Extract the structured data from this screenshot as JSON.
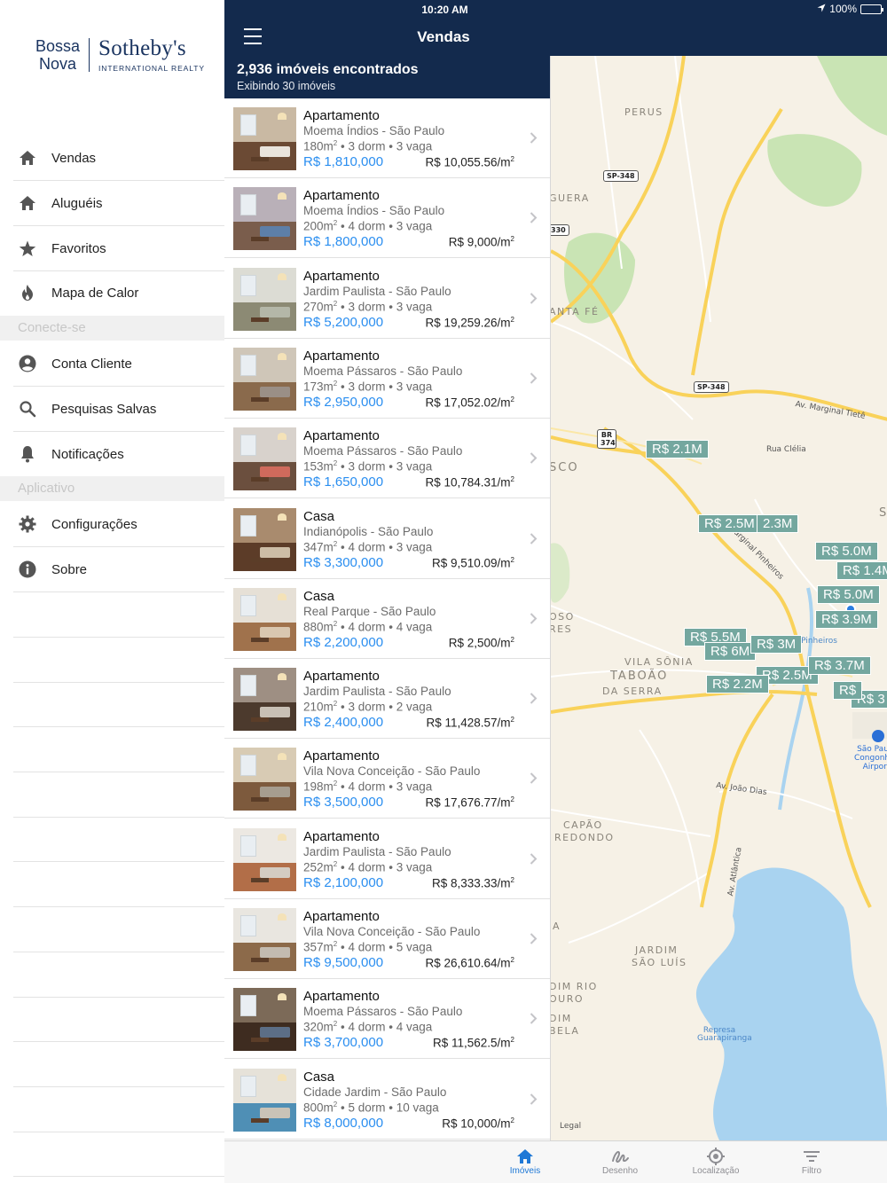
{
  "brand": {
    "line1": "Bossa",
    "line2": "Nova",
    "name": "Sotheby's",
    "tagline": "INTERNATIONAL REALTY"
  },
  "sidebar": {
    "items": [
      {
        "label": "Vendas",
        "icon": "home-icon"
      },
      {
        "label": "Aluguéis",
        "icon": "home-icon"
      },
      {
        "label": "Favoritos",
        "icon": "star-icon"
      },
      {
        "label": "Mapa de Calor",
        "icon": "flame-icon"
      }
    ],
    "section_connect": "Conecte-se",
    "connect_items": [
      {
        "label": "Conta Cliente",
        "icon": "user-circle-icon"
      },
      {
        "label": "Pesquisas Salvas",
        "icon": "search-icon"
      },
      {
        "label": "Notificações",
        "icon": "bell-icon"
      }
    ],
    "section_app": "Aplicativo",
    "app_items": [
      {
        "label": "Configurações",
        "icon": "gear-icon"
      },
      {
        "label": "Sobre",
        "icon": "info-icon"
      }
    ]
  },
  "status_bar": {
    "time": "10:20 AM",
    "battery": "100%"
  },
  "navbar": {
    "title": "Vendas"
  },
  "results": {
    "count": "2,936 imóveis encontrados",
    "showing": "Exibindo 30 imóveis"
  },
  "listings": [
    {
      "type": "Apartamento",
      "location": "Moema Índios - São Paulo",
      "area": "180m",
      "beds": "3 dorm",
      "parking": "3 vaga",
      "price": "R$ 1,810,000",
      "price_per_m2": "R$ 10,055.56/m"
    },
    {
      "type": "Apartamento",
      "location": "Moema Índios - São Paulo",
      "area": "200m",
      "beds": "4 dorm",
      "parking": "3 vaga",
      "price": "R$ 1,800,000",
      "price_per_m2": "R$ 9,000/m"
    },
    {
      "type": "Apartamento",
      "location": "Jardim Paulista - São Paulo",
      "area": "270m",
      "beds": "3 dorm",
      "parking": "3 vaga",
      "price": "R$ 5,200,000",
      "price_per_m2": "R$ 19,259.26/m"
    },
    {
      "type": "Apartamento",
      "location": "Moema Pássaros - São Paulo",
      "area": "173m",
      "beds": "3 dorm",
      "parking": "3 vaga",
      "price": "R$ 2,950,000",
      "price_per_m2": "R$ 17,052.02/m"
    },
    {
      "type": "Apartamento",
      "location": "Moema Pássaros - São Paulo",
      "area": "153m",
      "beds": "3 dorm",
      "parking": "3 vaga",
      "price": "R$ 1,650,000",
      "price_per_m2": "R$ 10,784.31/m"
    },
    {
      "type": "Casa",
      "location": "Indianópolis - São Paulo",
      "area": "347m",
      "beds": "4 dorm",
      "parking": "3 vaga",
      "price": "R$ 3,300,000",
      "price_per_m2": "R$ 9,510.09/m"
    },
    {
      "type": "Casa",
      "location": "Real Parque - São Paulo",
      "area": "880m",
      "beds": "4 dorm",
      "parking": "4 vaga",
      "price": "R$ 2,200,000",
      "price_per_m2": "R$ 2,500/m"
    },
    {
      "type": "Apartamento",
      "location": "Jardim Paulista - São Paulo",
      "area": "210m",
      "beds": "3 dorm",
      "parking": "2 vaga",
      "price": "R$ 2,400,000",
      "price_per_m2": "R$ 11,428.57/m"
    },
    {
      "type": "Apartamento",
      "location": "Vila Nova Conceição - São Paulo",
      "area": "198m",
      "beds": "4 dorm",
      "parking": "3 vaga",
      "price": "R$ 3,500,000",
      "price_per_m2": "R$ 17,676.77/m"
    },
    {
      "type": "Apartamento",
      "location": "Jardim Paulista - São Paulo",
      "area": "252m",
      "beds": "4 dorm",
      "parking": "3 vaga",
      "price": "R$ 2,100,000",
      "price_per_m2": "R$ 8,333.33/m"
    },
    {
      "type": "Apartamento",
      "location": "Vila Nova Conceição - São Paulo",
      "area": "357m",
      "beds": "4 dorm",
      "parking": "5 vaga",
      "price": "R$ 9,500,000",
      "price_per_m2": "R$ 26,610.64/m"
    },
    {
      "type": "Apartamento",
      "location": "Moema Pássaros - São Paulo",
      "area": "320m",
      "beds": "4 dorm",
      "parking": "4 vaga",
      "price": "R$ 3,700,000",
      "price_per_m2": "R$ 11,562.5/m"
    },
    {
      "type": "Casa",
      "location": "Cidade Jardim - São Paulo",
      "area": "800m",
      "beds": "5 dorm",
      "parking": "10 vaga",
      "price": "R$ 8,000,000",
      "price_per_m2": "R$ 10,000/m"
    }
  ],
  "map": {
    "areas": [
      "PERUS",
      "GUERA",
      "ANTA FÉ",
      "SCO",
      "OSO",
      "RES",
      "VILA SÔNIA",
      "TABOÃO",
      "DA SERRA",
      "CAPÃO",
      "REDONDO",
      "JARDIM",
      "SÃO LUÍS",
      "DIM RIO",
      "OURO",
      "DIM",
      "BELA",
      "A",
      "S"
    ],
    "roads": [
      "Av. Marginal Tietê",
      "Rua Clélia",
      "Marginal Pinheiros",
      "Av. João Dias",
      "Av. Atlântica",
      "Rio Pinheiros",
      "Represa Guarapiranga",
      "Legal"
    ],
    "shields": [
      "SP-348",
      "SP-348",
      "330",
      "BR 374"
    ],
    "airport": "São Paulo Congonhas Airport",
    "pins": [
      "R$ 2.1M",
      "R$ 2.5M",
      "2.3M",
      "R$ 5.0M",
      "R$ 1.4M",
      "R$ 5.0M",
      "R$ 3.9M",
      "R$ 5.5M",
      "R$ 6M",
      "R$ 3M",
      "R$ 2.5M",
      "R$ 2.2M",
      "R$ 3.7M",
      "R$ 3",
      "R$"
    ]
  },
  "tabs": [
    {
      "label": "Imóveis",
      "icon": "house-icon",
      "active": true
    },
    {
      "label": "Desenho",
      "icon": "draw-icon",
      "active": false
    },
    {
      "label": "Localização",
      "icon": "location-target-icon",
      "active": false
    },
    {
      "label": "Filtro",
      "icon": "filter-icon",
      "active": false
    }
  ],
  "colors": {
    "navy": "#132a4d",
    "accent_blue": "#2a8ef0",
    "pin_teal": "#74a79f",
    "map_bg": "#f6f1e6",
    "park_green": "#c9e4b4",
    "water_blue": "#a9d3f0",
    "highway_yellow": "#f9d25a"
  }
}
